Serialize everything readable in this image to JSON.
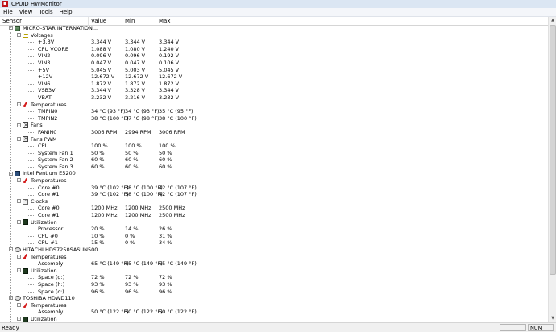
{
  "window": {
    "title": "CPUID HWMonitor"
  },
  "menu": [
    "File",
    "View",
    "Tools",
    "Help"
  ],
  "columns": {
    "sensor": "Sensor",
    "value": "Value",
    "min": "Min",
    "max": "Max"
  },
  "rows": [
    {
      "level": 0,
      "toggle": "-",
      "icon": "mb",
      "label": "MICRO-STAR INTERNATION...",
      "v": "",
      "mn": "",
      "mx": ""
    },
    {
      "level": 1,
      "toggle": "-",
      "icon": "volt",
      "label": "Voltages",
      "v": "",
      "mn": "",
      "mx": ""
    },
    {
      "level": 2,
      "label": "+3.3V",
      "v": "3.344 V",
      "mn": "3.344 V",
      "mx": "3.344 V"
    },
    {
      "level": 2,
      "label": "CPU VCORE",
      "v": "1.088 V",
      "mn": "1.080 V",
      "mx": "1.240 V"
    },
    {
      "level": 2,
      "label": "VIN2",
      "v": "0.096 V",
      "mn": "0.096 V",
      "mx": "0.192 V"
    },
    {
      "level": 2,
      "label": "VIN3",
      "v": "0.047 V",
      "mn": "0.047 V",
      "mx": "0.106 V"
    },
    {
      "level": 2,
      "label": "+5V",
      "v": "5.045 V",
      "mn": "5.003 V",
      "mx": "5.045 V"
    },
    {
      "level": 2,
      "label": "+12V",
      "v": "12.672 V",
      "mn": "12.672 V",
      "mx": "12.672 V"
    },
    {
      "level": 2,
      "label": "VIN6",
      "v": "1.872 V",
      "mn": "1.872 V",
      "mx": "1.872 V"
    },
    {
      "level": 2,
      "label": "VSB3V",
      "v": "3.344 V",
      "mn": "3.328 V",
      "mx": "3.344 V"
    },
    {
      "level": 2,
      "label": "VBAT",
      "v": "3.232 V",
      "mn": "3.216 V",
      "mx": "3.232 V"
    },
    {
      "level": 1,
      "toggle": "-",
      "icon": "temp",
      "label": "Temperatures",
      "v": "",
      "mn": "",
      "mx": ""
    },
    {
      "level": 2,
      "label": "TMPIN0",
      "v": "34 °C  (93 °F)",
      "mn": "34 °C  (93 °F)",
      "mx": "35 °C  (95 °F)"
    },
    {
      "level": 2,
      "label": "TMPIN2",
      "v": "38 °C  (100 °F)",
      "mn": "37 °C  (98 °F)",
      "mx": "38 °C  (100 °F)"
    },
    {
      "level": 1,
      "toggle": "-",
      "icon": "fan",
      "label": "Fans",
      "v": "",
      "mn": "",
      "mx": ""
    },
    {
      "level": 2,
      "label": "FANIN0",
      "v": "3006 RPM",
      "mn": "2994 RPM",
      "mx": "3006 RPM"
    },
    {
      "level": 1,
      "toggle": "-",
      "icon": "fanpwm",
      "label": "Fans PWM",
      "v": "",
      "mn": "",
      "mx": ""
    },
    {
      "level": 2,
      "label": "CPU",
      "v": "100 %",
      "mn": "100 %",
      "mx": "100 %"
    },
    {
      "level": 2,
      "label": "System Fan 1",
      "v": "50 %",
      "mn": "50 %",
      "mx": "50 %"
    },
    {
      "level": 2,
      "label": "System Fan 2",
      "v": "60 %",
      "mn": "60 %",
      "mx": "60 %"
    },
    {
      "level": 2,
      "label": "System Fan 3",
      "v": "60 %",
      "mn": "60 %",
      "mx": "60 %"
    },
    {
      "level": 0,
      "toggle": "-",
      "icon": "cpu",
      "label": "Intel Pentium E5200",
      "v": "",
      "mn": "",
      "mx": ""
    },
    {
      "level": 1,
      "toggle": "-",
      "icon": "temp",
      "label": "Temperatures",
      "v": "",
      "mn": "",
      "mx": ""
    },
    {
      "level": 2,
      "label": "Core #0",
      "v": "39 °C  (102 °F)",
      "mn": "38 °C  (100 °F)",
      "mx": "42 °C  (107 °F)"
    },
    {
      "level": 2,
      "label": "Core #1",
      "v": "39 °C  (102 °F)",
      "mn": "38 °C  (100 °F)",
      "mx": "42 °C  (107 °F)"
    },
    {
      "level": 1,
      "toggle": "-",
      "icon": "clock",
      "label": "Clocks",
      "v": "",
      "mn": "",
      "mx": ""
    },
    {
      "level": 2,
      "label": "Core #0",
      "v": "1200 MHz",
      "mn": "1200 MHz",
      "mx": "2500 MHz"
    },
    {
      "level": 2,
      "label": "Core #1",
      "v": "1200 MHz",
      "mn": "1200 MHz",
      "mx": "2500 MHz"
    },
    {
      "level": 1,
      "toggle": "-",
      "icon": "util",
      "label": "Utilization",
      "v": "",
      "mn": "",
      "mx": ""
    },
    {
      "level": 2,
      "label": "Processor",
      "v": "20 %",
      "mn": "14 %",
      "mx": "26 %"
    },
    {
      "level": 2,
      "label": "CPU #0",
      "v": "10 %",
      "mn": "0 %",
      "mx": "31 %"
    },
    {
      "level": 2,
      "label": "CPU #1",
      "v": "15 %",
      "mn": "0 %",
      "mx": "34 %"
    },
    {
      "level": 0,
      "toggle": "-",
      "icon": "disk",
      "label": "HITACHI HDS7250SASUN500...",
      "v": "",
      "mn": "",
      "mx": ""
    },
    {
      "level": 1,
      "toggle": "-",
      "icon": "temp",
      "label": "Temperatures",
      "v": "",
      "mn": "",
      "mx": ""
    },
    {
      "level": 2,
      "label": "Assembly",
      "v": "65 °C  (149 °F)",
      "mn": "65 °C  (149 °F)",
      "mx": "65 °C  (149 °F)"
    },
    {
      "level": 1,
      "toggle": "-",
      "icon": "util",
      "label": "Utilization",
      "v": "",
      "mn": "",
      "mx": ""
    },
    {
      "level": 2,
      "label": "Space (g:)",
      "v": "72 %",
      "mn": "72 %",
      "mx": "72 %"
    },
    {
      "level": 2,
      "label": "Space (h:)",
      "v": "93 %",
      "mn": "93 %",
      "mx": "93 %"
    },
    {
      "level": 2,
      "label": "Space (c:)",
      "v": "96 %",
      "mn": "96 %",
      "mx": "96 %"
    },
    {
      "level": 0,
      "toggle": "-",
      "icon": "disk",
      "label": "TOSHIBA HDWD110",
      "v": "",
      "mn": "",
      "mx": ""
    },
    {
      "level": 1,
      "toggle": "-",
      "icon": "temp",
      "label": "Temperatures",
      "v": "",
      "mn": "",
      "mx": ""
    },
    {
      "level": 2,
      "label": "Assembly",
      "v": "50 °C  (122 °F)",
      "mn": "50 °C  (122 °F)",
      "mx": "50 °C  (122 °F)"
    },
    {
      "level": 1,
      "toggle": "-",
      "icon": "util",
      "label": "Utilization",
      "v": "",
      "mn": "",
      "mx": ""
    }
  ],
  "status": {
    "ready": "Ready",
    "num": "NUM"
  }
}
